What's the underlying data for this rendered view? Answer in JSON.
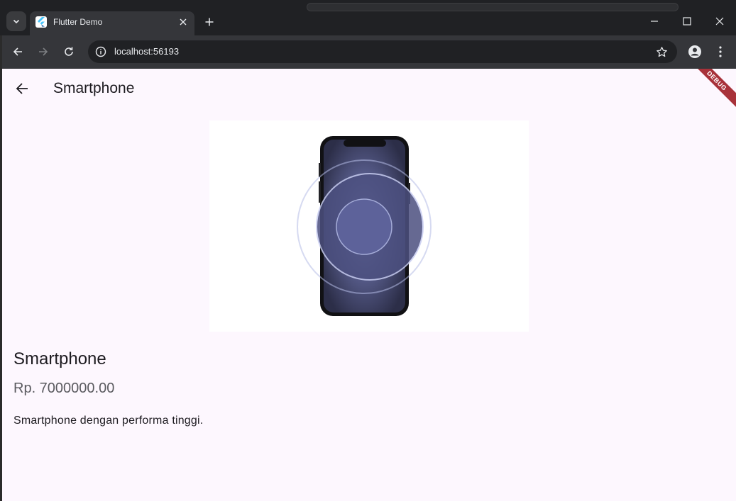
{
  "browser": {
    "tab": {
      "title": "Flutter Demo"
    },
    "address": {
      "url": "localhost:56193"
    }
  },
  "app": {
    "appbar_title": "Smartphone",
    "debug_banner": "DEBUG"
  },
  "product": {
    "name": "Smartphone",
    "price": "Rp. 7000000.00",
    "description": "Smartphone dengan performa tinggi.",
    "image_icon": "smartphone-image"
  },
  "colors": {
    "page_background": "#fdf7fe",
    "debug_banner": "#a8323a",
    "browser_frame": "#202124",
    "toolbar": "#35363a"
  }
}
